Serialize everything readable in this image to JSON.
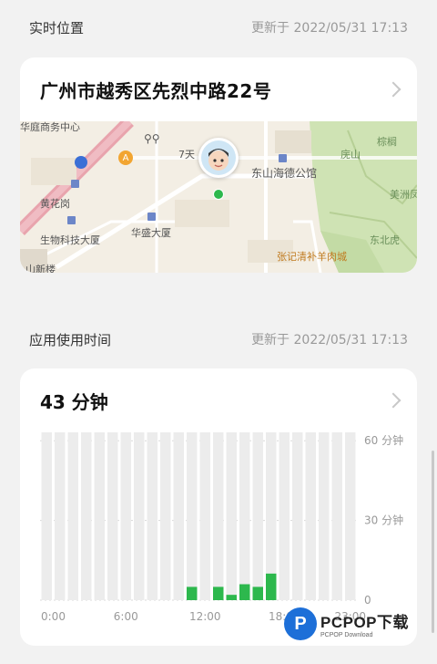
{
  "location_section": {
    "title": "实时位置",
    "updated": "更新于 2022/05/31 17:13"
  },
  "location_card": {
    "address": "广州市越秀区先烈中路22号",
    "chevron_icon": "chevron-right-icon",
    "map": {
      "labels": {
        "top_left": "华庭商务中心",
        "hotel": "7天",
        "poi_east": "东山海德公馆",
        "huanghuagang": "黄花岗",
        "biotech": "生物科技大厦",
        "huasheng": "华盛大厦",
        "restaurant": "张记清补羊肉城",
        "park1": "庑山",
        "park2": "棕榈",
        "park3": "美洲凤",
        "park4": "东北虎",
        "bottom_left": "山新楼"
      },
      "marker_badge": "A",
      "accent": "#2db84d"
    }
  },
  "usage_section": {
    "title": "应用使用时间",
    "updated": "更新于 2022/05/31 17:13"
  },
  "usage_card": {
    "total": "43 分钟",
    "chevron_icon": "chevron-right-icon"
  },
  "chart_data": {
    "type": "bar",
    "categories": [
      "0",
      "1",
      "2",
      "3",
      "4",
      "5",
      "6",
      "7",
      "8",
      "9",
      "10",
      "11",
      "12",
      "13",
      "14",
      "15",
      "16",
      "17",
      "18",
      "19",
      "20",
      "21",
      "22",
      "23"
    ],
    "values": [
      0,
      0,
      0,
      0,
      0,
      0,
      0,
      0,
      0,
      0,
      0,
      5,
      0,
      5,
      2,
      6,
      5,
      10,
      0,
      0,
      0,
      0,
      0,
      0
    ],
    "x_tick_labels": [
      "0:00",
      "6:00",
      "12:00",
      "18:00",
      "23:00"
    ],
    "y_tick_labels": [
      "60 分钟",
      "30 分钟",
      "0"
    ],
    "ylim": [
      0,
      60
    ],
    "bar_color": "#2db84d",
    "background_bar_color": "#ececec"
  },
  "watermark": {
    "logo_letter": "P",
    "main": "PCPOP下载",
    "sub": "PCPOP Download"
  }
}
